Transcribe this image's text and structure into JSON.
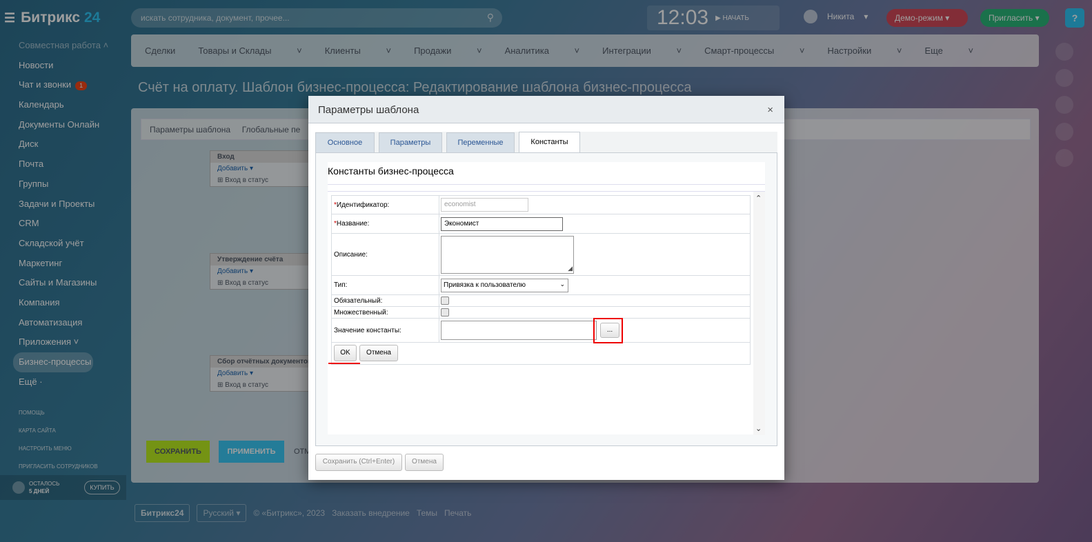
{
  "header": {
    "logo": "Битрикс",
    "logo_num": "24",
    "search_placeholder": "искать сотрудника, документ, прочее...",
    "time": "12:03",
    "start_label": "НАЧАТЬ",
    "user_name": "Никита",
    "demo_label": "Демо-режим",
    "invite_label": "Пригласить",
    "help_label": "?"
  },
  "sidebar": {
    "group_label": "Совместная работа",
    "items": [
      "Новости",
      "Чат и звонки",
      "Календарь",
      "Документы Онлайн",
      "Диск",
      "Почта",
      "Группы",
      "Задачи и Проекты",
      "CRM",
      "Складской учёт",
      "Маркетинг",
      "Сайты и Магазины",
      "Компания",
      "Автоматизация",
      "Приложения",
      "Бизнес-процессы",
      "Ещё"
    ],
    "chat_badge": "1",
    "small_links": [
      "Помощь",
      "Карта сайта",
      "Настроить меню",
      "Пригласить сотрудников"
    ],
    "trial_line1": "ОСТАЛОСЬ",
    "trial_line2": "5 ДНЕЙ",
    "buy_label": "КУПИТЬ"
  },
  "topmenu": [
    "Сделки",
    "Товары и Склады",
    "Клиенты",
    "Продажи",
    "Аналитика",
    "Интеграции",
    "Смарт-процессы",
    "Настройки",
    "Еще"
  ],
  "page_title": "Счёт на оплату. Шаблон бизнес-процесса: Редактирование шаблона бизнес-процесса",
  "workspace": {
    "toolbar_items": [
      "Параметры шаблона",
      "Глобальные пе"
    ],
    "blocks": [
      {
        "title": "Вход",
        "add": "Добавить",
        "row": "Вход в статус"
      },
      {
        "title": "Утверждение счёта",
        "add": "Добавить",
        "row": "Вход в статус"
      },
      {
        "title": "Сбор отчётных документов",
        "add": "Добавить",
        "row": "Вход в статус"
      }
    ],
    "save": "СОХРАНИТЬ",
    "apply": "ПРИМЕНИТЬ",
    "cancel_partial": "ОТМ"
  },
  "footer": {
    "logo": "Битрикс24",
    "lang": "Русский",
    "copyright": "© «Битрикс», 2023",
    "order": "Заказать внедрение",
    "themes": "Темы",
    "print": "Печать"
  },
  "dialog": {
    "title": "Параметры шаблона",
    "close": "×",
    "tabs": [
      "Основное",
      "Параметры",
      "Переменные",
      "Константы"
    ],
    "active_tab": "Константы",
    "section_title": "Константы бизнес-процесса",
    "form": {
      "id_label": "Идентификатор:",
      "id_value": "economist",
      "name_label": "Название:",
      "name_value": "Экономист",
      "desc_label": "Описание:",
      "type_label": "Тип:",
      "type_value": "Привязка к пользователю",
      "required_label": "Обязательный:",
      "multiple_label": "Множественный:",
      "value_label": "Значение константы:",
      "picker_label": "...",
      "ok_label": "OK",
      "cancel_label": "Отмена"
    },
    "footer_save": "Сохранить (Ctrl+Enter)",
    "footer_cancel": "Отмена"
  }
}
